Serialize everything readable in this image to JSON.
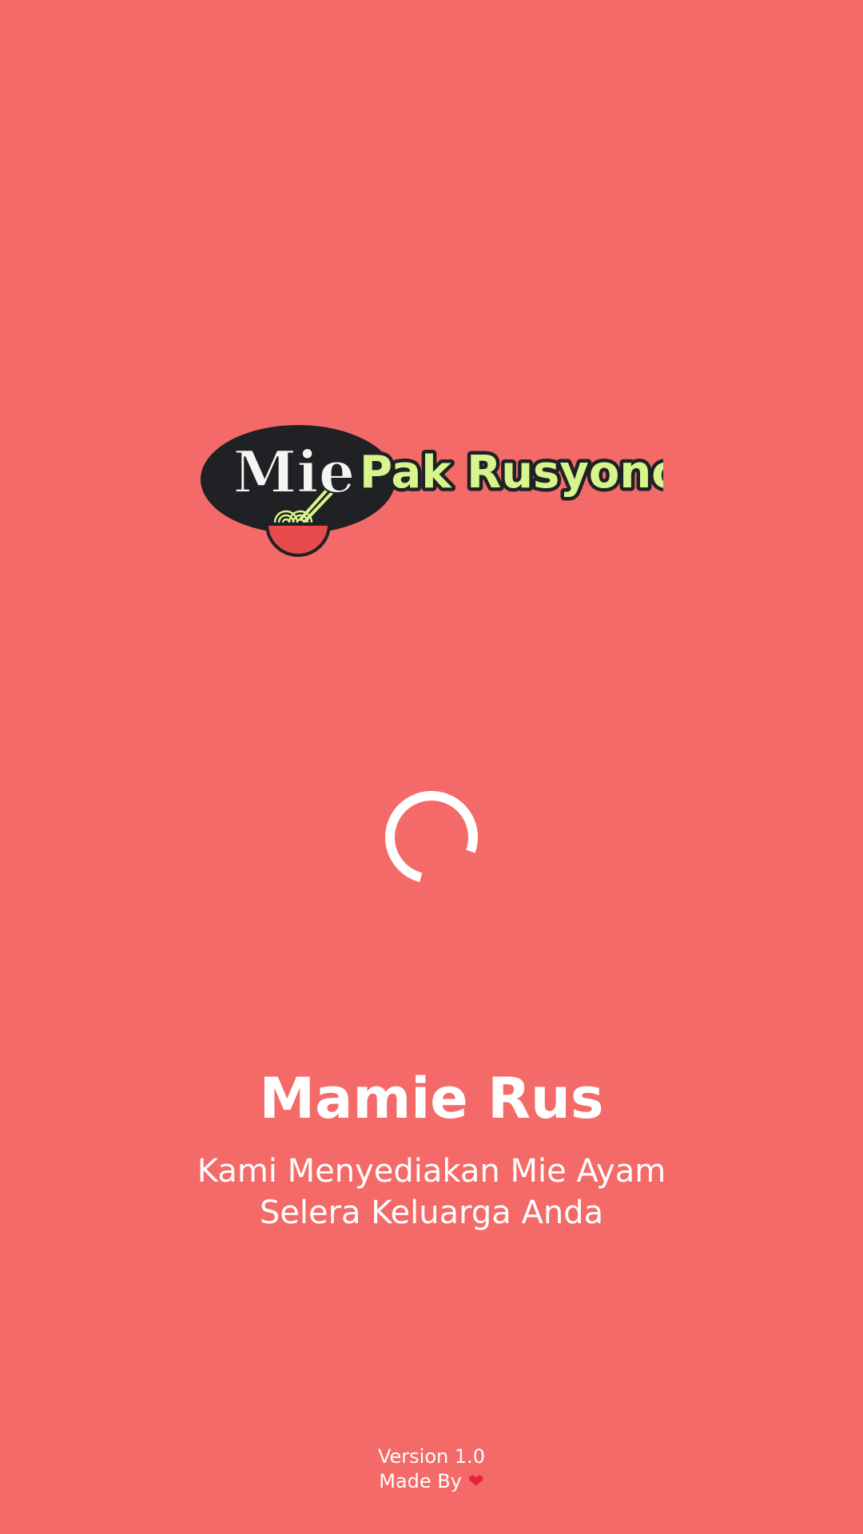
{
  "theme": {
    "background": "#F46A68",
    "text": "#FFFFFF",
    "spinner": "#FFFFFF",
    "logo_dark": "#1F2124",
    "logo_green": "#D7F58C",
    "logo_bowl": "#E84B4B"
  },
  "logo": {
    "word_mie": "Mie",
    "word_brand": "Pak Rusyono",
    "icon": "noodle-bowl-icon"
  },
  "loading": {
    "icon": "loading-spinner-icon"
  },
  "app": {
    "name": "Mamie Rus",
    "tagline_line1": "Kami Menyediakan Mie Ayam",
    "tagline_line2": "Selera Keluarga Anda"
  },
  "footer": {
    "version": "Version 1.0",
    "made_by": "Made By",
    "heart_icon": "heart-icon",
    "heart_glyph": "❤"
  }
}
